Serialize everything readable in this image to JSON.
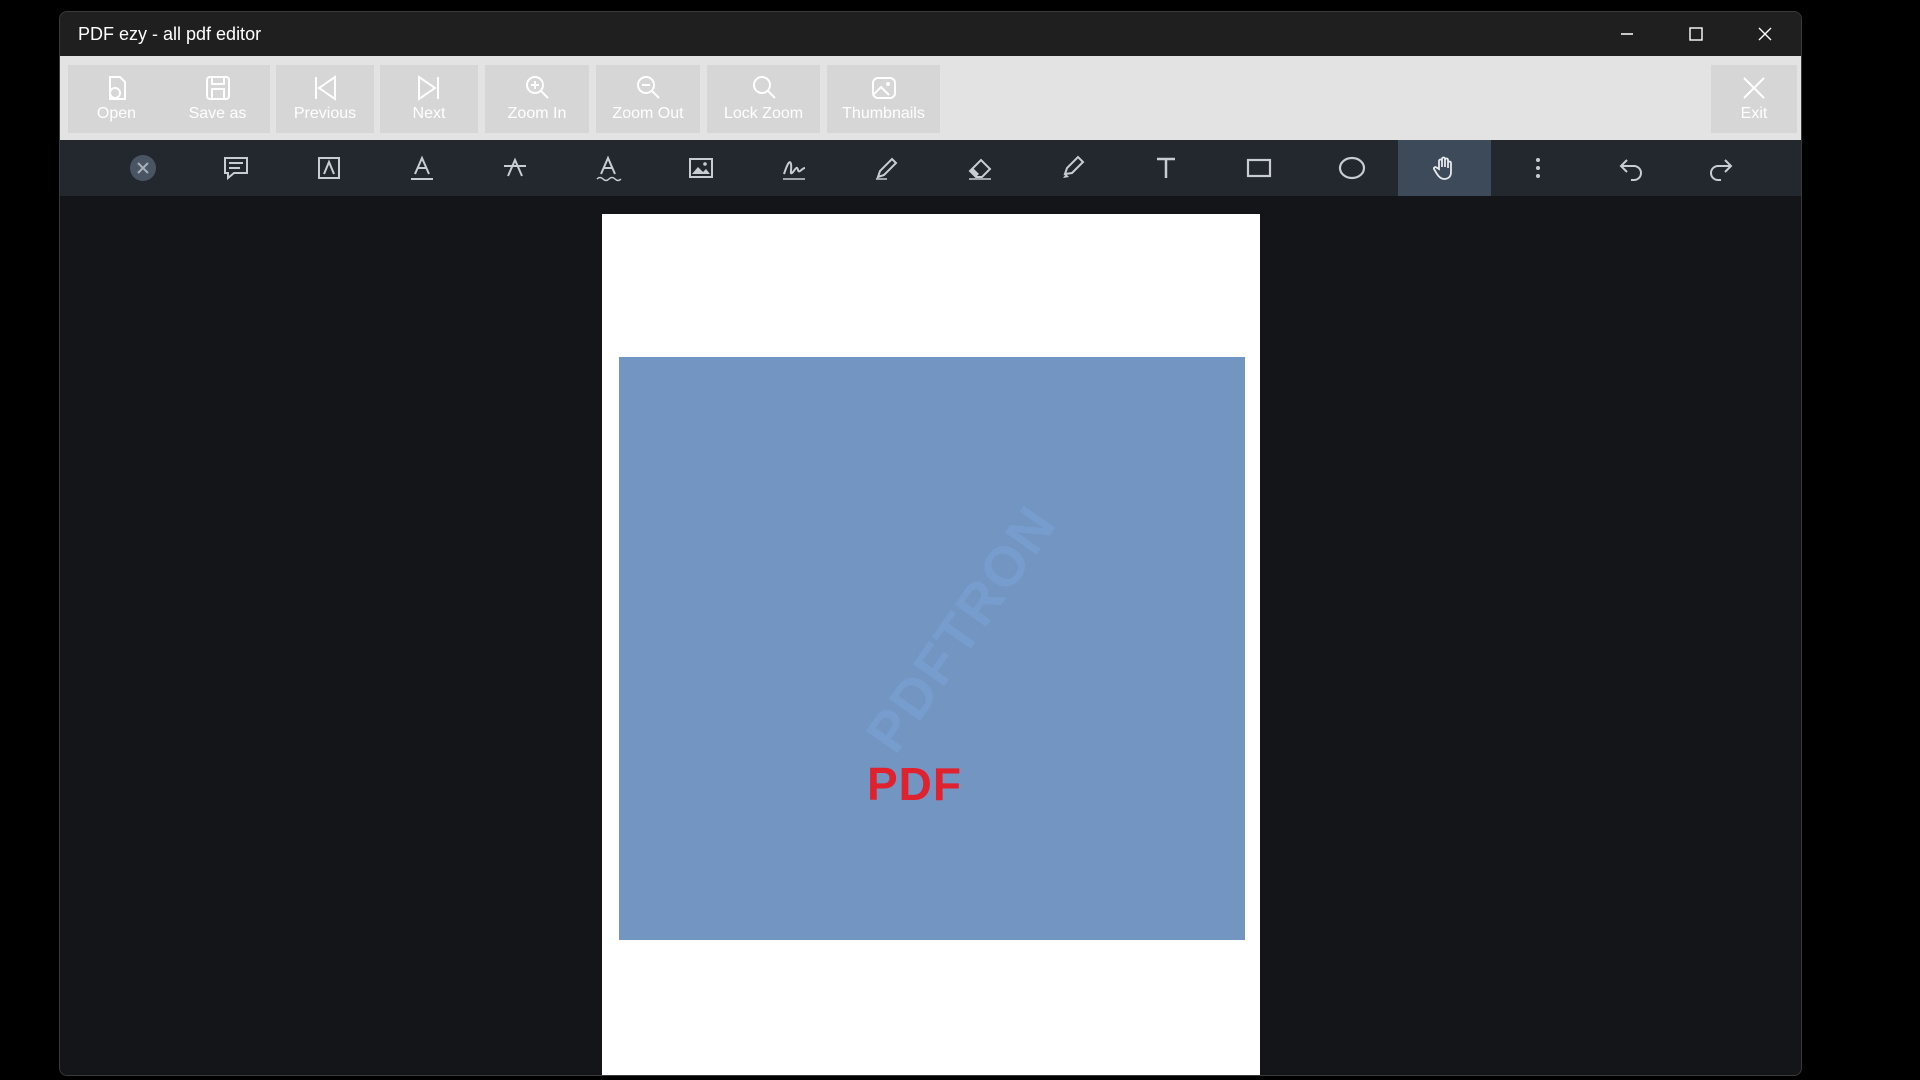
{
  "window": {
    "title": "PDF ezy - all pdf editor"
  },
  "toolbar": {
    "buttons": [
      {
        "label": "Open",
        "icon": "open-file-icon"
      },
      {
        "label": "Save as",
        "icon": "save-icon"
      },
      {
        "label": "Previous",
        "icon": "previous-icon"
      },
      {
        "label": "Next",
        "icon": "next-icon"
      },
      {
        "label": "Zoom In",
        "icon": "zoom-in-icon"
      },
      {
        "label": "Zoom Out",
        "icon": "zoom-out-icon"
      },
      {
        "label": "Lock Zoom",
        "icon": "lock-zoom-icon"
      },
      {
        "label": "Thumbnails",
        "icon": "thumbnails-icon"
      }
    ],
    "exit_label": "Exit"
  },
  "annotation_tools": [
    "close-icon",
    "comment-icon",
    "free-text-icon",
    "underline-icon",
    "strikeout-icon",
    "squiggly-icon",
    "image-icon",
    "signature-icon",
    "pen-icon",
    "eraser-icon",
    "highlighter-icon",
    "text-icon",
    "rectangle-icon",
    "ellipse-icon",
    "pan-icon",
    "more-icon",
    "undo-icon",
    "redo-icon"
  ],
  "active_tool": "pan-icon",
  "document": {
    "watermark": "PDFTRON",
    "image_text": "PDF"
  },
  "colors": {
    "accent_active": "#3d4a5a",
    "image_bg": "#7295c2",
    "pdf_red": "#e0222e"
  }
}
